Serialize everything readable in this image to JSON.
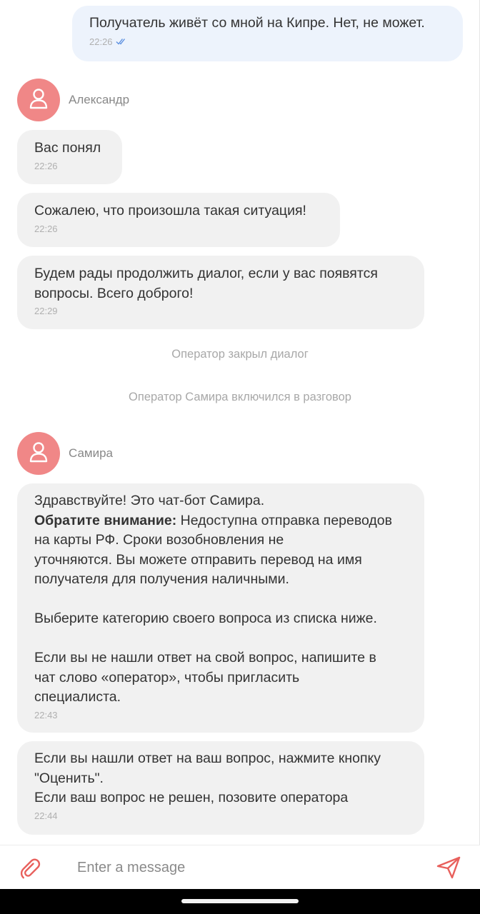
{
  "messages": {
    "out1": {
      "text": "Получатель живёт со мной на Кипре. Нет, не может.",
      "time": "22:26"
    },
    "alex": {
      "name": "Александр",
      "m1": {
        "text": "Вас понял",
        "time": "22:26"
      },
      "m2": {
        "text": "Сожалею, что произошла такая ситуация!",
        "time": "22:26"
      },
      "m3": {
        "text": "Будем рады продолжить диалог, если у вас появятся\nвопросы. Всего доброго!",
        "time": "22:29"
      }
    },
    "system1": "Оператор закрыл диалог",
    "system2": "Оператор Самира включился в разговор",
    "samira": {
      "name": "Самира",
      "m1": {
        "line1": "Здравствуйте! Это чат-бот Самира.",
        "bold": "Обратите внимание:",
        "rest": " Недоступна отправка переводов\nна карты РФ. Сроки возобновления не\nуточняются. Вы можете отправить перевод на имя\nполучателя для получения наличными.\n\nВыберите категорию своего вопроса из списка ниже.\n\nЕсли вы не нашли ответ на свой вопрос, напишите в\nчат слово «оператор», чтобы пригласить\nспециалиста.",
        "time": "22:43"
      },
      "m2": {
        "text": "Если вы нашли ответ на ваш вопрос, нажмите кнопку\n\"Оценить\".\nЕсли ваш вопрос не решен, позовите оператора",
        "time": "22:44"
      }
    }
  },
  "composer": {
    "placeholder": "Enter a message"
  },
  "icons": {
    "attach": "paperclip-icon",
    "send": "send-icon",
    "read": "double-check-icon",
    "avatar": "user-icon"
  },
  "colors": {
    "accent": "#e8605c",
    "avatar": "#f08787",
    "incoming": "#f1f1f1",
    "outgoing": "#edf3fc",
    "read_check": "#5b8fe0"
  }
}
